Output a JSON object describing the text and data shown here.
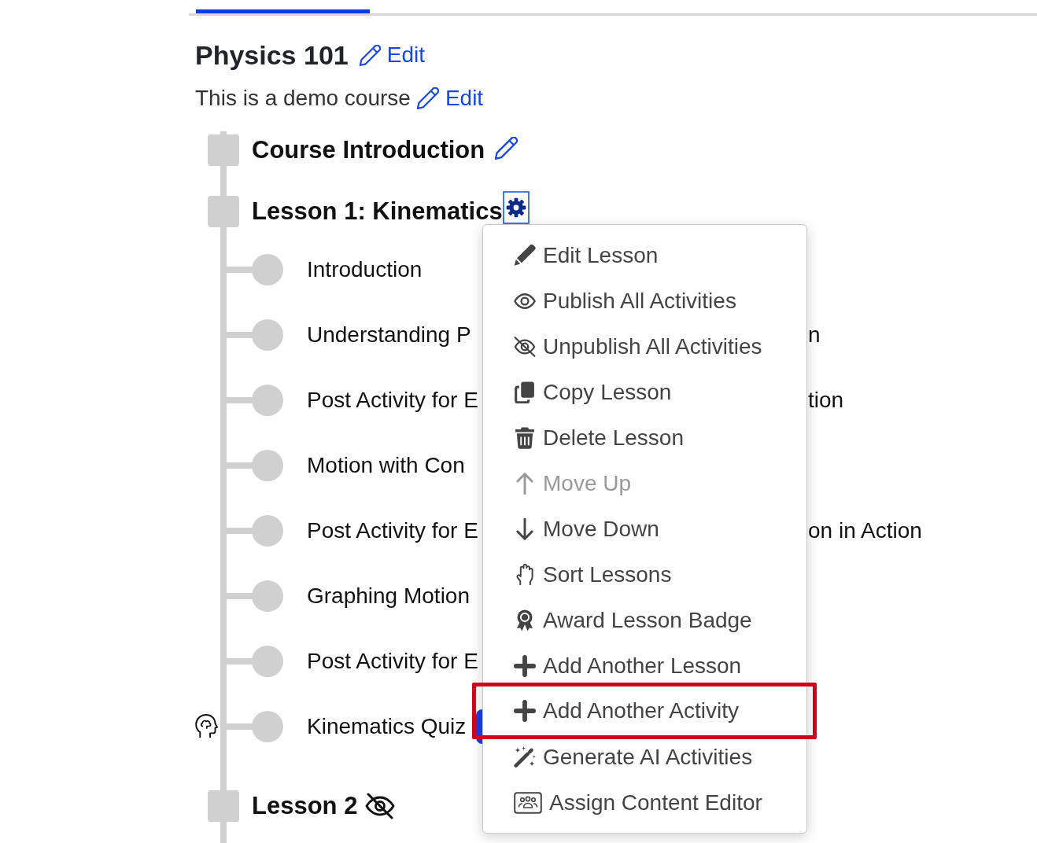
{
  "course": {
    "title": "Physics 101",
    "title_edit": "Edit",
    "description": "This is a demo course",
    "description_edit": "Edit"
  },
  "outline": [
    {
      "kind": "intro",
      "title": "Course Introduction",
      "published": true,
      "menu_open": false
    },
    {
      "kind": "lesson",
      "title": "Lesson 1: Kinematics",
      "published": true,
      "menu_open": true,
      "activities": [
        {
          "kind": "activity",
          "title": "Introduction",
          "has_badge": false
        },
        {
          "kind": "activity",
          "title": "Understanding P",
          "title_end": "n",
          "has_badge": false
        },
        {
          "kind": "activity",
          "title": "Post Activity for E",
          "title_end": "tion",
          "has_badge": false
        },
        {
          "kind": "activity",
          "title": "Motion with Con",
          "has_badge": false
        },
        {
          "kind": "activity",
          "title": "Post Activity for E",
          "title_end": "on in Action",
          "has_badge": false
        },
        {
          "kind": "activity",
          "title": "Graphing Motion",
          "has_badge": false
        },
        {
          "kind": "activity",
          "title": "Post Activity for E",
          "has_badge": false
        },
        {
          "kind": "quiz",
          "title": "Kinematics Quiz",
          "has_badge": true
        }
      ]
    },
    {
      "kind": "lesson",
      "title": "Lesson 2",
      "published": false,
      "menu_open": false
    }
  ],
  "lesson_menu": {
    "items": [
      {
        "label": "Edit Lesson",
        "disabled": false,
        "highlighted": false
      },
      {
        "label": "Publish All Activities",
        "disabled": false,
        "highlighted": false
      },
      {
        "label": "Unpublish All Activities",
        "disabled": false,
        "highlighted": false
      },
      {
        "label": "Copy Lesson",
        "disabled": false,
        "highlighted": false
      },
      {
        "label": "Delete Lesson",
        "disabled": false,
        "highlighted": false
      },
      {
        "label": "Move Up",
        "disabled": true,
        "highlighted": false
      },
      {
        "label": "Move Down",
        "disabled": false,
        "highlighted": false
      },
      {
        "label": "Sort Lessons",
        "disabled": false,
        "highlighted": false
      },
      {
        "label": "Award Lesson Badge",
        "disabled": false,
        "highlighted": false
      },
      {
        "label": "Add Another Lesson",
        "disabled": false,
        "highlighted": false
      },
      {
        "label": "Add Another Activity",
        "disabled": false,
        "highlighted": true
      },
      {
        "label": "Generate AI Activities",
        "disabled": false,
        "highlighted": false
      },
      {
        "label": "Assign Content Editor",
        "disabled": false,
        "highlighted": false
      }
    ]
  }
}
